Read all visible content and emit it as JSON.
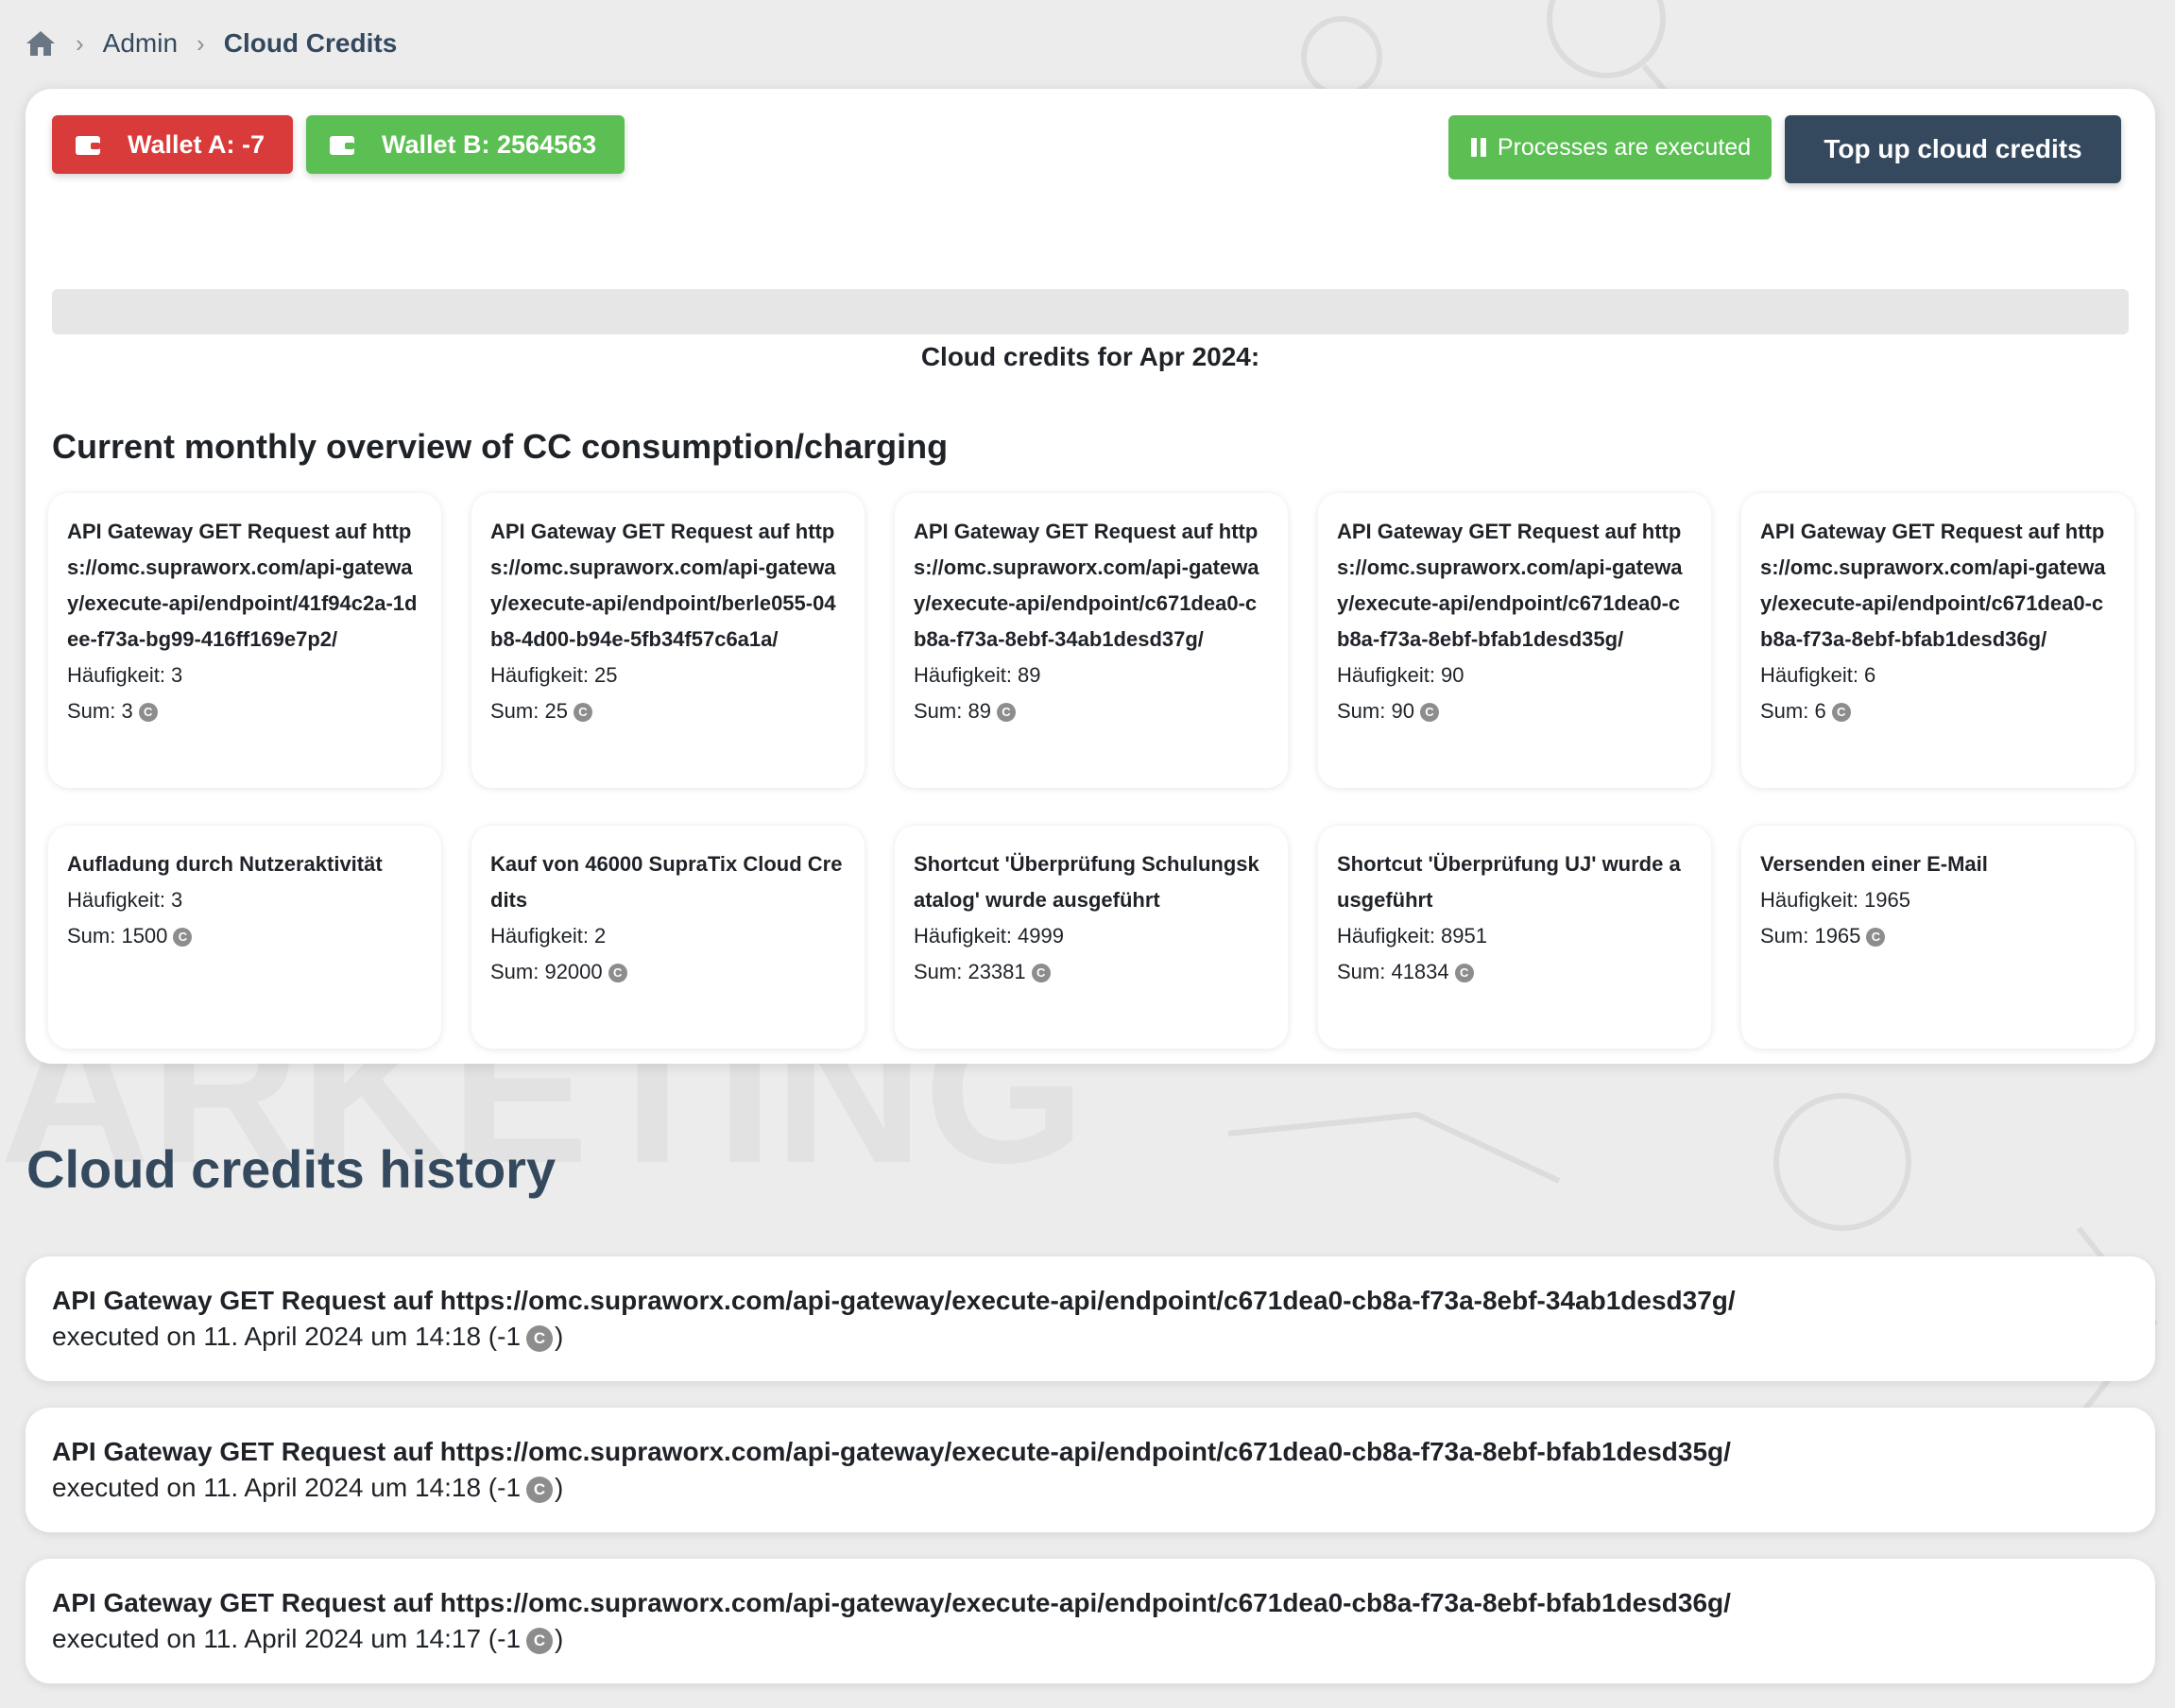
{
  "breadcrumb": {
    "items": [
      "Admin",
      "Cloud Credits"
    ]
  },
  "wallets": {
    "a_label": "Wallet A: -7",
    "b_label": "Wallet B: 2564563"
  },
  "actions": {
    "processes_label": "Processes are executed",
    "topup_label": "Top up cloud credits"
  },
  "progress": {
    "value": 0
  },
  "credits_month": "Cloud credits for Apr 2024:",
  "overview": {
    "title": "Current monthly overview of CC consumption/charging",
    "cards": [
      {
        "title": "API Gateway GET Request auf https://omc.supraworx.com/api-gateway/execute-api/endpoint/41f94c2a-1dee-f73a-bg99-416ff169e7p2/",
        "freq": "Häufigkeit: 3",
        "sum": "Sum: 3"
      },
      {
        "title": "API Gateway GET Request auf https://omc.supraworx.com/api-gateway/execute-api/endpoint/berle055-04b8-4d00-b94e-5fb34f57c6a1a/",
        "freq": "Häufigkeit: 25",
        "sum": "Sum: 25"
      },
      {
        "title": "API Gateway GET Request auf https://omc.supraworx.com/api-gateway/execute-api/endpoint/c671dea0-cb8a-f73a-8ebf-34ab1desd37g/",
        "freq": "Häufigkeit: 89",
        "sum": "Sum: 89"
      },
      {
        "title": "API Gateway GET Request auf https://omc.supraworx.com/api-gateway/execute-api/endpoint/c671dea0-cb8a-f73a-8ebf-bfab1desd35g/",
        "freq": "Häufigkeit: 90",
        "sum": "Sum: 90"
      },
      {
        "title": "API Gateway GET Request auf https://omc.supraworx.com/api-gateway/execute-api/endpoint/c671dea0-cb8a-f73a-8ebf-bfab1desd36g/",
        "freq": "Häufigkeit: 6",
        "sum": "Sum: 6"
      },
      {
        "title": "Aufladung durch Nutzeraktivität",
        "freq": "Häufigkeit: 3",
        "sum": "Sum: 1500"
      },
      {
        "title": "Kauf von 46000 SupraTix Cloud Credits",
        "freq": "Häufigkeit: 2",
        "sum": "Sum: 92000"
      },
      {
        "title": "Shortcut 'Überprüfung Schulungskatalog' wurde ausgeführt",
        "freq": "Häufigkeit: 4999",
        "sum": "Sum: 23381"
      },
      {
        "title": "Shortcut 'Überprüfung UJ' wurde ausgeführt",
        "freq": "Häufigkeit: 8951",
        "sum": "Sum: 41834"
      },
      {
        "title": "Versenden einer E-Mail",
        "freq": "Häufigkeit: 1965",
        "sum": "Sum: 1965"
      }
    ]
  },
  "coin_glyph": "C",
  "history": {
    "title": "Cloud credits history",
    "items": [
      {
        "title": "API Gateway GET Request auf https://omc.supraworx.com/api-gateway/execute-api/endpoint/c671dea0-cb8a-f73a-8ebf-34ab1desd37g/",
        "executed": "executed on 11. April 2024 um 14:18 (-1",
        "close": ")"
      },
      {
        "title": "API Gateway GET Request auf https://omc.supraworx.com/api-gateway/execute-api/endpoint/c671dea0-cb8a-f73a-8ebf-bfab1desd35g/",
        "executed": "executed on 11. April 2024 um 14:18 (-1",
        "close": ")"
      },
      {
        "title": "API Gateway GET Request auf https://omc.supraworx.com/api-gateway/execute-api/endpoint/c671dea0-cb8a-f73a-8ebf-bfab1desd36g/",
        "executed": "executed on 11. April 2024 um 14:17 (-1",
        "close": ")"
      }
    ]
  }
}
